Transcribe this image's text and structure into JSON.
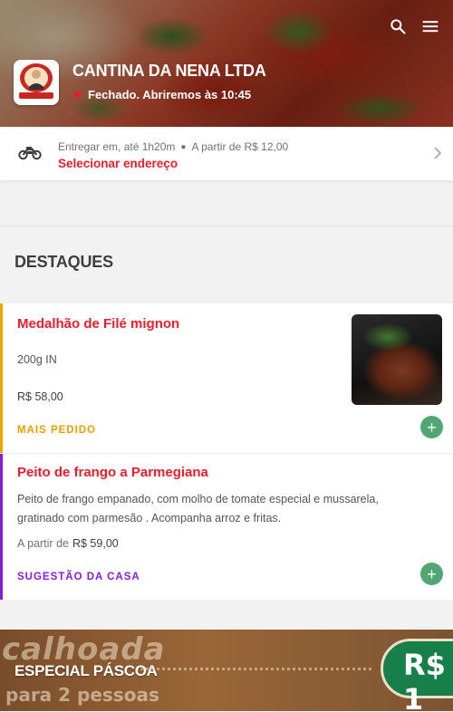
{
  "store": {
    "name": "CANTINA DA NENA LTDA",
    "status": "Fechado. Abriremos às 10:45"
  },
  "delivery": {
    "eta": "Entregar em, até 1h20m",
    "min_order": "A partir de R$ 12,00",
    "select_address": "Selecionar endereço"
  },
  "section": {
    "title": "DESTAQUES"
  },
  "items": [
    {
      "name": "Medalhão de Filé mignon",
      "description": "200g IN",
      "price": "R$ 58,00",
      "tag": "MAIS PEDIDO",
      "tag_color": "#e8a000"
    },
    {
      "name": "Peito de frango a Parmegiana",
      "description_line1": "Peito de frango empanado, com molho de tomate especial e mussarela,",
      "description_line2": "gratinado com parmesão . Acompanha arroz e fritas.",
      "price_prefix": "A partir de",
      "price": "R$ 59,00",
      "tag": "SUGESTÃO DA CASA",
      "tag_color": "#8a1cd6"
    }
  ],
  "banner": {
    "title": "ESPECIAL PÁSCOA",
    "image_text_top": "calhoada",
    "image_text_bottom": "para 2 pessoas",
    "image_price": "R$ 1"
  },
  "colors": {
    "accent": "#ea1d2c",
    "add": "#50a773"
  },
  "icons": [
    "search-icon",
    "menu-icon",
    "motorcycle-icon",
    "chevron-right-icon",
    "plus-icon"
  ]
}
